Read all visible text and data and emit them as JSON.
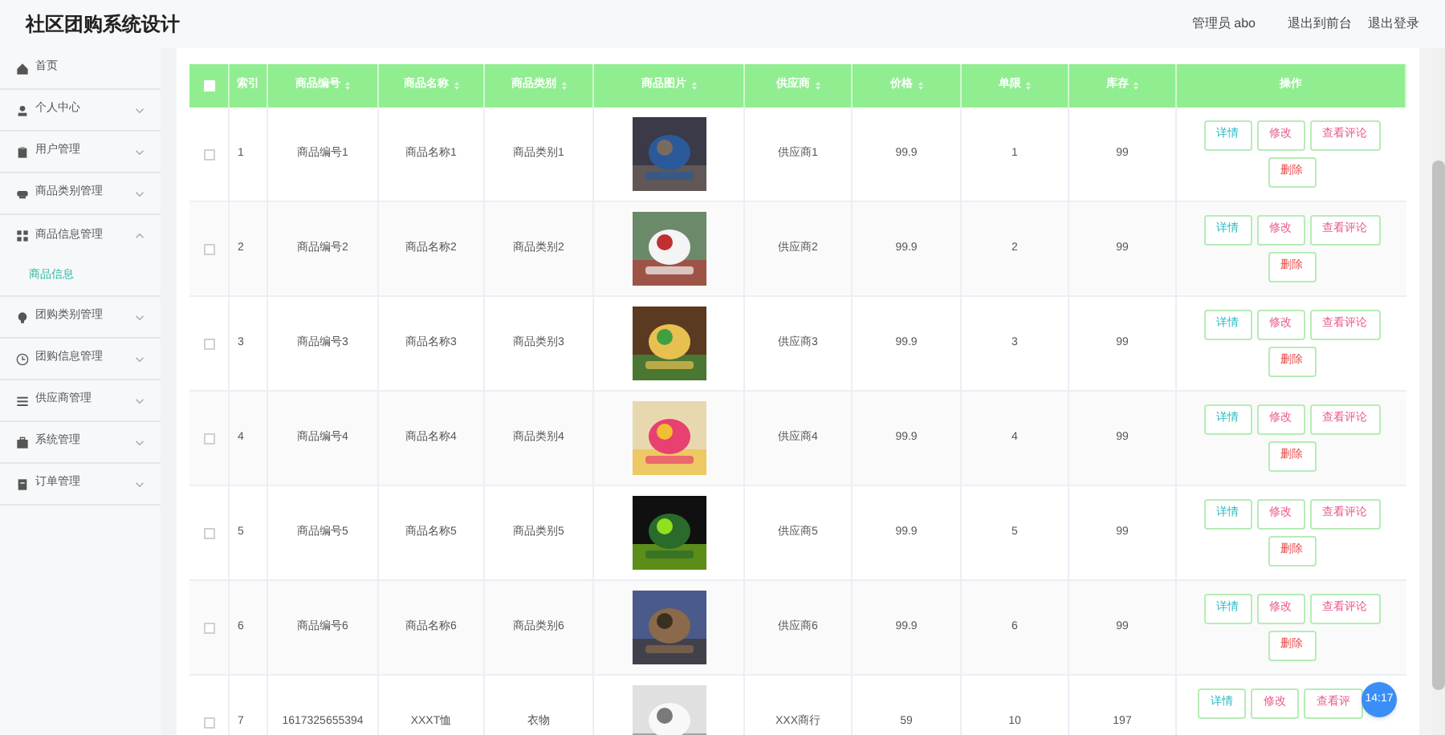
{
  "header": {
    "title": "社区团购系统设计",
    "user": "管理员 abo",
    "links": [
      "退出到前台",
      "退出登录"
    ]
  },
  "sidebar": {
    "items": [
      {
        "label": "首页",
        "kind": "home"
      },
      {
        "label": "个人中心",
        "kind": "user",
        "expanded": false
      },
      {
        "label": "用户管理",
        "kind": "clipboard",
        "expanded": false
      },
      {
        "label": "商品类别管理",
        "kind": "stack",
        "expanded": false
      },
      {
        "label": "商品信息管理",
        "kind": "grid",
        "expanded": true,
        "children": [
          {
            "label": "商品信息",
            "selected": true
          }
        ]
      },
      {
        "label": "团购类别管理",
        "kind": "bulb",
        "expanded": false
      },
      {
        "label": "团购信息管理",
        "kind": "clock",
        "expanded": false
      },
      {
        "label": "供应商管理",
        "kind": "list",
        "expanded": false
      },
      {
        "label": "系统管理",
        "kind": "case",
        "expanded": false
      },
      {
        "label": "订单管理",
        "kind": "doc",
        "expanded": false
      }
    ]
  },
  "table": {
    "all_checked": false,
    "columns": [
      {
        "label": "索引",
        "sortable": false
      },
      {
        "label": "商品编号",
        "sortable": true
      },
      {
        "label": "商品名称",
        "sortable": true
      },
      {
        "label": "商品类别",
        "sortable": true
      },
      {
        "label": "商品图片",
        "sortable": true
      },
      {
        "label": "供应商",
        "sortable": true
      },
      {
        "label": "价格",
        "sortable": true
      },
      {
        "label": "单限",
        "sortable": true
      },
      {
        "label": "库存",
        "sortable": true
      },
      {
        "label": "操作",
        "sortable": false
      }
    ],
    "rows": [
      {
        "checked": false,
        "cells": [
          "1",
          "商品编号1",
          "商品名称1",
          "商品类别1",
          null,
          "供应商1",
          "99.9",
          "1",
          "99"
        ],
        "image": {
          "kind": "picture"
        },
        "actions": [
          {
            "label": "详情",
            "kind": "detail"
          },
          {
            "label": "修改",
            "kind": "edit"
          },
          {
            "label": "查看评论",
            "kind": "comments"
          },
          {
            "label": "删除",
            "kind": "delete"
          }
        ]
      },
      {
        "checked": false,
        "cells": [
          "2",
          "商品编号2",
          "商品名称2",
          "商品类别2",
          null,
          "供应商2",
          "99.9",
          "2",
          "99"
        ],
        "image": {
          "kind": "picture"
        },
        "actions": [
          {
            "label": "详情",
            "kind": "detail"
          },
          {
            "label": "修改",
            "kind": "edit"
          },
          {
            "label": "查看评论",
            "kind": "comments"
          },
          {
            "label": "删除",
            "kind": "delete"
          }
        ]
      },
      {
        "checked": false,
        "cells": [
          "3",
          "商品编号3",
          "商品名称3",
          "商品类别3",
          null,
          "供应商3",
          "99.9",
          "3",
          "99"
        ],
        "image": {
          "kind": "picture"
        },
        "actions": [
          {
            "label": "详情",
            "kind": "detail"
          },
          {
            "label": "修改",
            "kind": "edit"
          },
          {
            "label": "查看评论",
            "kind": "comments"
          },
          {
            "label": "删除",
            "kind": "delete"
          }
        ]
      },
      {
        "checked": false,
        "cells": [
          "4",
          "商品编号4",
          "商品名称4",
          "商品类别4",
          null,
          "供应商4",
          "99.9",
          "4",
          "99"
        ],
        "image": {
          "kind": "picture"
        },
        "actions": [
          {
            "label": "详情",
            "kind": "detail"
          },
          {
            "label": "修改",
            "kind": "edit"
          },
          {
            "label": "查看评论",
            "kind": "comments"
          },
          {
            "label": "删除",
            "kind": "delete"
          }
        ]
      },
      {
        "checked": false,
        "cells": [
          "5",
          "商品编号5",
          "商品名称5",
          "商品类别5",
          null,
          "供应商5",
          "99.9",
          "5",
          "99"
        ],
        "image": {
          "kind": "picture"
        },
        "actions": [
          {
            "label": "详情",
            "kind": "detail"
          },
          {
            "label": "修改",
            "kind": "edit"
          },
          {
            "label": "查看评论",
            "kind": "comments"
          },
          {
            "label": "删除",
            "kind": "delete"
          }
        ]
      },
      {
        "checked": false,
        "cells": [
          "6",
          "商品编号6",
          "商品名称6",
          "商品类别6",
          null,
          "供应商6",
          "99.9",
          "6",
          "99"
        ],
        "image": {
          "kind": "picture"
        },
        "actions": [
          {
            "label": "详情",
            "kind": "detail"
          },
          {
            "label": "修改",
            "kind": "edit"
          },
          {
            "label": "查看评论",
            "kind": "comments"
          },
          {
            "label": "删除",
            "kind": "delete"
          }
        ]
      },
      {
        "checked": false,
        "cells": [
          "7",
          "1617325655394",
          "XXXT恤",
          "衣物",
          null,
          "XXX商行",
          "59",
          "10",
          "197"
        ],
        "image": {
          "kind": "picture"
        },
        "actions": [
          {
            "label": "详情",
            "kind": "detail"
          },
          {
            "label": "修改",
            "kind": "edit"
          },
          {
            "label": "查看评",
            "kind": "comments"
          }
        ]
      }
    ]
  },
  "floating_badge": "14:17"
}
